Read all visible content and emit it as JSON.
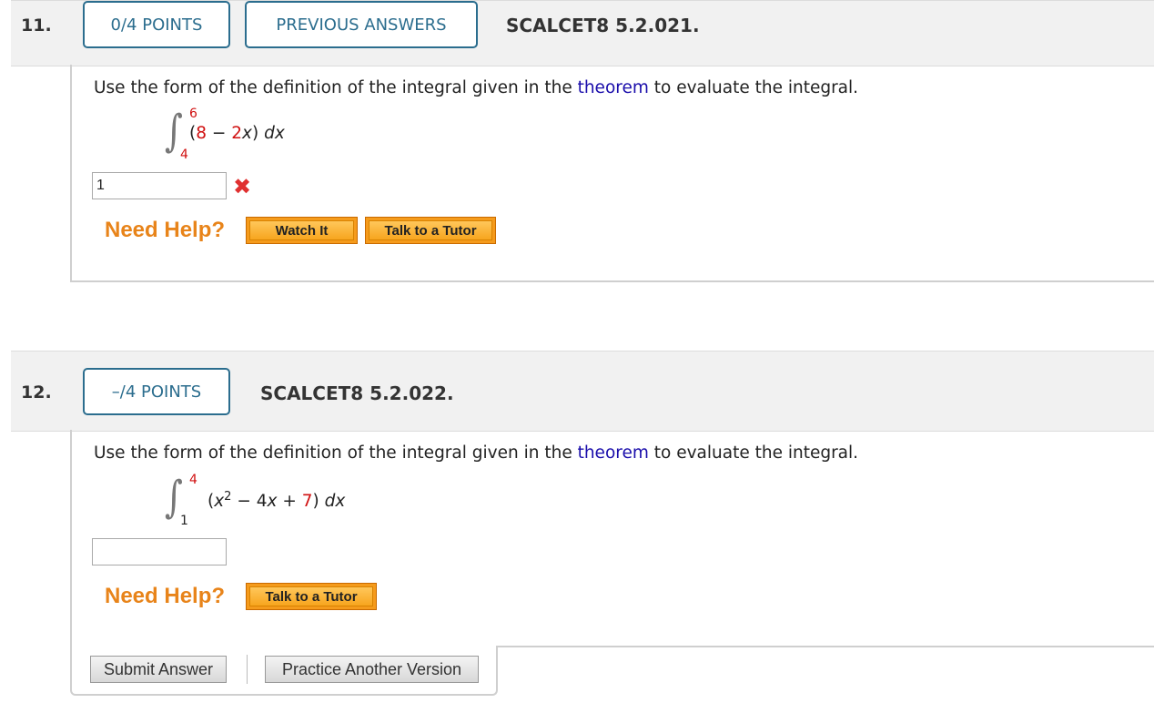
{
  "q11": {
    "number": "11.",
    "points": "0/4 POINTS",
    "previous_answers": "PREVIOUS ANSWERS",
    "code": "SCALCET8 5.2.021.",
    "prompt_before": "Use the form of the definition of the integral given in the ",
    "prompt_link": "theorem",
    "prompt_after": " to evaluate the integral.",
    "upper_limit": "6",
    "lower_limit": "4",
    "integrand": {
      "open": "(",
      "a": "8",
      "minus": " − ",
      "b": "2",
      "var": "x",
      "close": ") ",
      "dx": "dx"
    },
    "answer_value": "1",
    "need_help": "Need Help?",
    "watch_it": "Watch It",
    "talk_tutor": "Talk to a Tutor"
  },
  "q12": {
    "number": "12.",
    "points": "–/4 POINTS",
    "code": "SCALCET8 5.2.022.",
    "prompt_before": "Use the form of the definition of the integral given in the ",
    "prompt_link": "theorem",
    "prompt_after": " to evaluate the integral.",
    "upper_limit": "4",
    "lower_limit": "1",
    "integrand": {
      "open": "(",
      "var": "x",
      "exp": "2",
      "mid": " − 4",
      "var2": "x",
      "plus": " + ",
      "c": "7",
      "close": ") ",
      "dx": "dx"
    },
    "answer_value": "",
    "need_help": "Need Help?",
    "talk_tutor": "Talk to a Tutor"
  },
  "footer": {
    "submit": "Submit Answer",
    "practice": "Practice Another Version"
  },
  "colors": {
    "pill_border": "#2b6d8e",
    "help_orange": "#e8841a",
    "red": "#d01010",
    "link": "#1a0dab"
  },
  "icons": {
    "incorrect": "x-mark-icon"
  }
}
